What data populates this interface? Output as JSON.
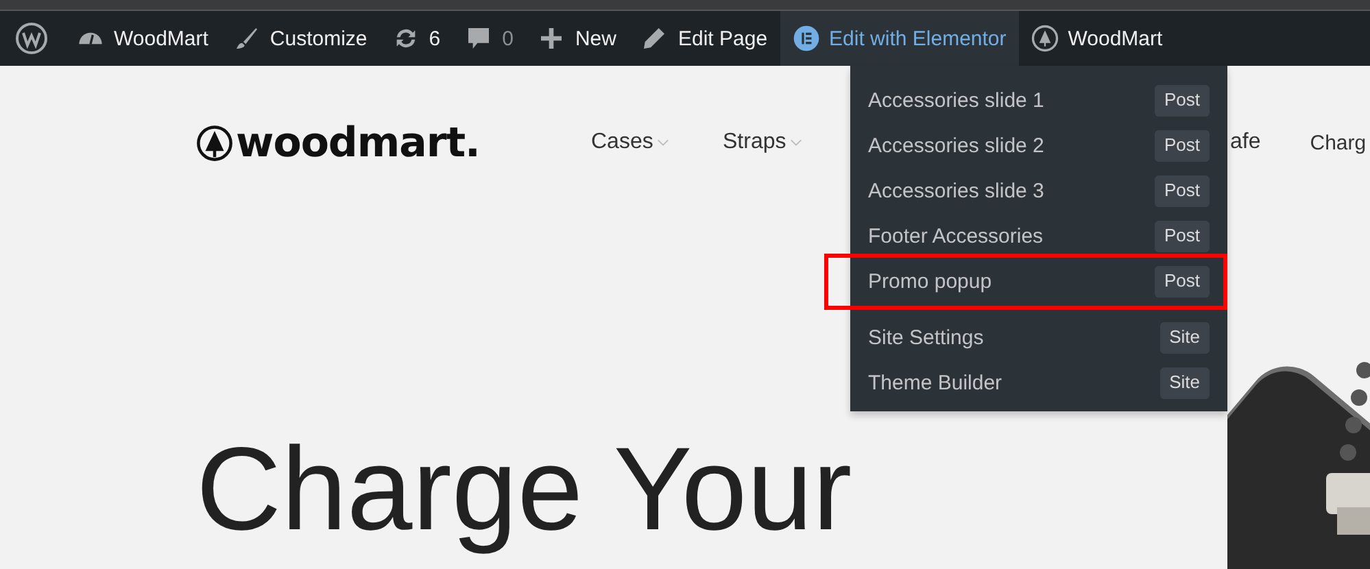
{
  "admin_bar": {
    "items": [
      {
        "selected": false
      },
      {
        "label": "WoodMart",
        "selected": false
      },
      {
        "label": "Customize",
        "selected": false
      },
      {
        "label": "6",
        "selected": false
      },
      {
        "label": "0",
        "selected": false
      },
      {
        "label": "New",
        "selected": false
      },
      {
        "label": "Edit Page",
        "selected": false
      },
      {
        "label": "Edit with Elementor",
        "selected": true
      },
      {
        "label": "WoodMart",
        "selected": false
      }
    ]
  },
  "elementor_menu": {
    "groups": [
      {
        "items": [
          {
            "label": "Accessories slide 1",
            "badge": "Post",
            "highlighted": false
          },
          {
            "label": "Accessories slide 2",
            "badge": "Post",
            "highlighted": false
          },
          {
            "label": "Accessories slide 3",
            "badge": "Post",
            "highlighted": false
          },
          {
            "label": "Footer Accessories",
            "badge": "Post",
            "highlighted": false
          },
          {
            "label": "Promo popup",
            "badge": "Post",
            "highlighted": true
          }
        ]
      },
      {
        "items": [
          {
            "label": "Site Settings",
            "badge": "Site",
            "highlighted": false
          },
          {
            "label": "Theme Builder",
            "badge": "Site",
            "highlighted": false
          }
        ]
      }
    ]
  },
  "site_header": {
    "logo": "woodmart.",
    "nav": [
      {
        "label": "Cases",
        "dropdown": true
      },
      {
        "label": "Straps",
        "dropdown": true
      },
      {
        "label": "afe",
        "dropdown": false
      },
      {
        "label": "Charg",
        "dropdown": false
      }
    ]
  },
  "hero": {
    "heading": "Charge Your"
  }
}
